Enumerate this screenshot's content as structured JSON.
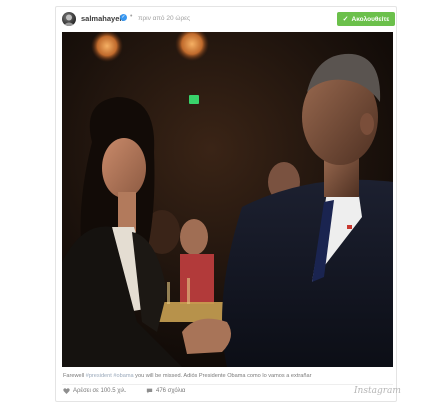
{
  "post": {
    "username": "salmahayek",
    "time": "πριν από 20 ώρες",
    "follow_label": "Ακολουθείτε",
    "caption_prefix": "Farewell",
    "caption_tag1": "#president",
    "caption_tag2": "#obama",
    "caption_text": "you will be missed. Adiós Presidente Obama como lo vamos a extrañar",
    "likes": "Αρέσει σε 100.5 χιλ.",
    "comments": "476 σχόλια",
    "brand": "Instagram"
  },
  "colors": {
    "follow_button": "#6bc04b",
    "verified_badge": "#3897f0",
    "hashtag": "#9aa9bb"
  },
  "icons": [
    "verified-icon",
    "check-icon",
    "heart-icon",
    "comment-icon"
  ]
}
